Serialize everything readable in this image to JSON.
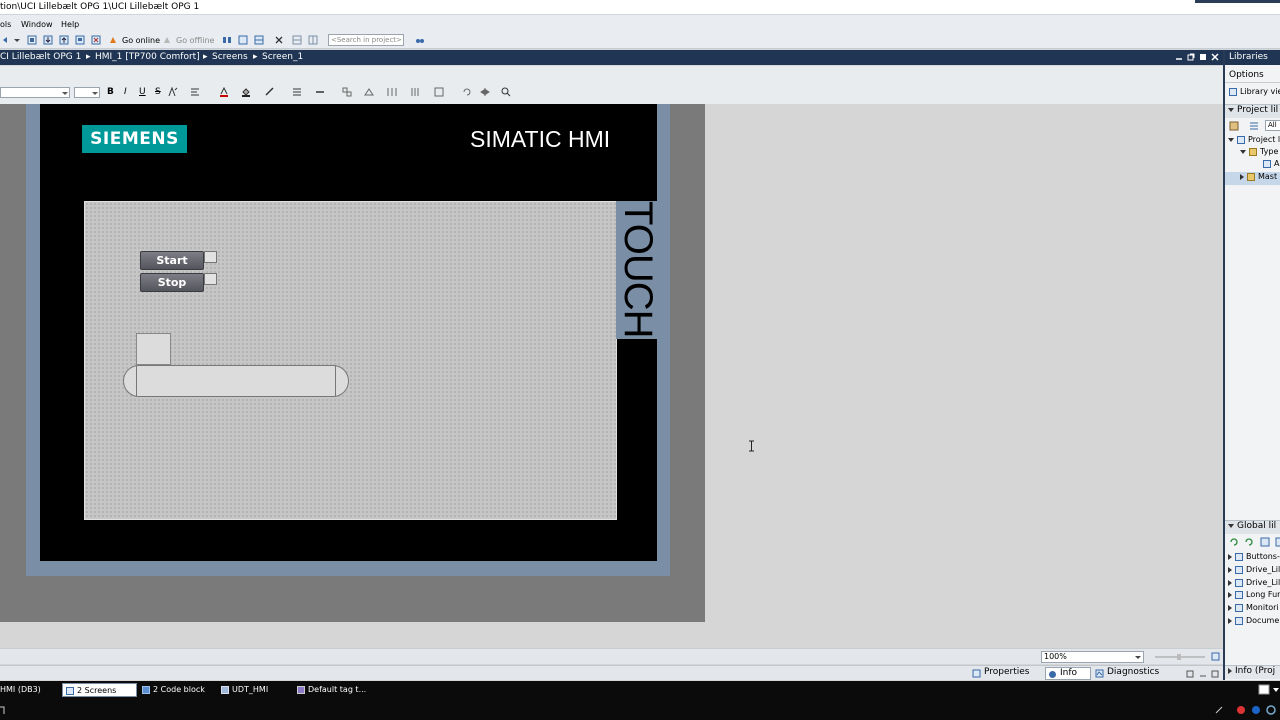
{
  "window": {
    "title": "tion\\UCI Lillebælt OPG 1\\UCI Lillebælt OPG 1"
  },
  "menu": {
    "items": [
      "ols",
      "Window",
      "Help"
    ]
  },
  "toolbar": {
    "go_online": "Go online",
    "go_offline": "Go offline",
    "search_placeholder": "<Search in project>"
  },
  "breadcrumb": {
    "items": [
      "CI Lillebælt OPG 1",
      "HMI_1 [TP700 Comfort]",
      "Screens",
      "Screen_1"
    ]
  },
  "format_toolbar": {
    "bold": "B",
    "italic": "I",
    "underline": "U",
    "strike": "S"
  },
  "hmi_panel": {
    "brand": "SIEMENS",
    "model": "SIMATIC HMI",
    "touch_label": "TOUCH",
    "buttons": [
      "Start",
      "Stop"
    ]
  },
  "zoom": {
    "value": "100%"
  },
  "bottom_tabs": {
    "properties": "Properties",
    "info": "Info",
    "diagnostics": "Diagnostics"
  },
  "libraries_panel": {
    "title": "Libraries",
    "options": "Options",
    "library_view": "Library vie",
    "project_lib": "Project lil",
    "filter": "All",
    "project_tree": [
      "Project li",
      "Type",
      "A",
      "Mast"
    ],
    "global_lib": "Global lil",
    "global_items": [
      "Buttons-",
      "Drive_Lil",
      "Drive_Lil",
      "Long Fur",
      "Monitori",
      "Docume"
    ],
    "info_tab": "Info (Proj"
  },
  "taskbar": {
    "tabs": [
      "HMI (DB3)",
      "2 Screens",
      "2 Code block",
      "UDT_HMI",
      "Default tag t..."
    ]
  },
  "colors": {
    "breadcrumb_bg": "#1f3553",
    "siemens_teal": "#009999",
    "panel_frame": "#7a8ea6"
  }
}
